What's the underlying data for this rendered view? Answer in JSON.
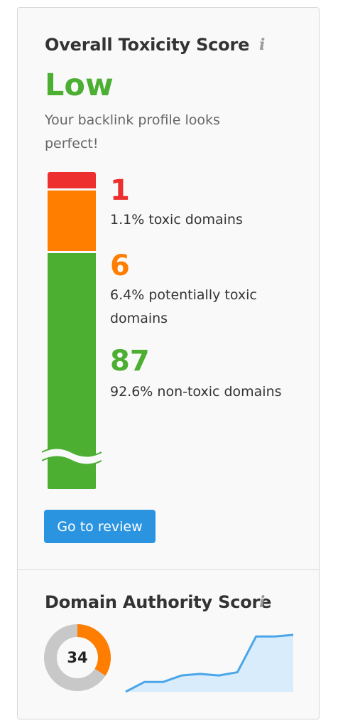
{
  "toxicity": {
    "title": "Overall Toxicity Score",
    "info_icon": "info-icon",
    "level": "Low",
    "description": "Your backlink profile looks perfect!",
    "toxic": {
      "count": "1",
      "label": "1.1% toxic domains"
    },
    "potentially_toxic": {
      "count": "6",
      "label": "6.4% potentially toxic domains"
    },
    "non_toxic": {
      "count": "87",
      "label": "92.6% non-toxic domains"
    },
    "review_button": "Go to review"
  },
  "authority": {
    "title": "Domain Authority Score",
    "info_icon": "info-icon",
    "score": "34",
    "score_fraction": 0.34,
    "trend": [
      0,
      3,
      3,
      5,
      5.5,
      5,
      6,
      17,
      17,
      17.5
    ]
  },
  "colors": {
    "red": "#ee2f2f",
    "orange": "#ff7e00",
    "green": "#4caf32",
    "blue": "#2b94e1",
    "donut_track": "#c8c8c8",
    "trend_line": "#4aa6e8",
    "trend_fill": "#d8ecfb"
  }
}
